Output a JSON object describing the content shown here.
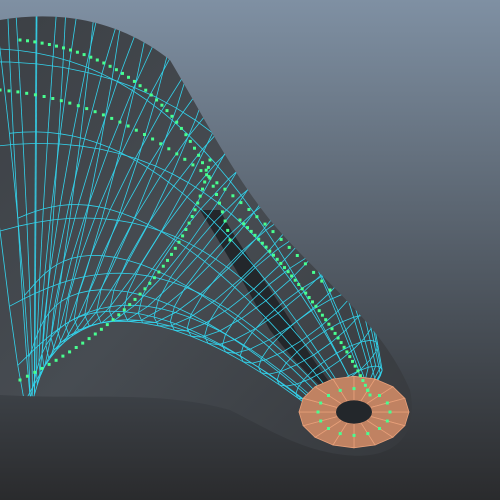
{
  "viewport": {
    "background_top": "#7f90a3",
    "background_bottom": "#2a2b2d"
  },
  "mesh": {
    "object": "nurbs-pipe-surface",
    "surface_color": "#444a50",
    "inner_color": "#23272b",
    "wireframe_color": "#33d3ec",
    "selected_face_color": "#c08262",
    "selected_edge_color": "#e8a07a",
    "vertex_color": "#3ef08a",
    "vertex_dot_color": "#48ff90"
  }
}
